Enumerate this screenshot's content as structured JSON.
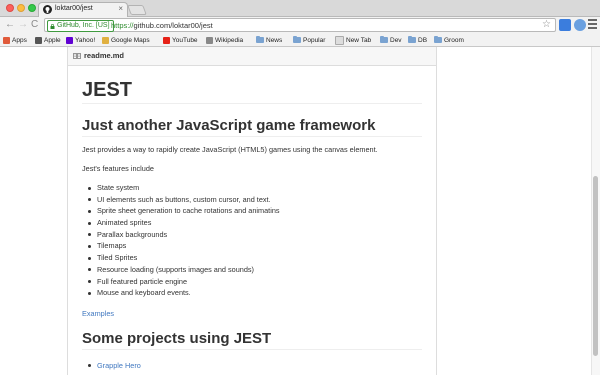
{
  "browser": {
    "tab_title": "loktar00/jest",
    "tab_close": "×",
    "ev_badge": "GitHub, Inc. [US]",
    "url_scheme": "https://",
    "url_rest": "github.com/loktar00/jest",
    "star": "☆",
    "nav": {
      "back": "←",
      "forward": "→",
      "reload": "C"
    }
  },
  "bookmarks": [
    {
      "label": "Apps",
      "icon": "apps-grid-icon",
      "color": "#e05a3a"
    },
    {
      "label": "Apple",
      "icon": "apple-icon",
      "color": "#555555"
    },
    {
      "label": "Yahoo!",
      "icon": "yahoo-icon",
      "color": "#6001d2"
    },
    {
      "label": "Google Maps",
      "icon": "google-maps-icon",
      "color": "#e0b040"
    },
    {
      "label": "YouTube",
      "icon": "youtube-icon",
      "color": "#e62117"
    },
    {
      "label": "Wikipedia",
      "icon": "wikipedia-icon",
      "color": "#888888"
    },
    {
      "label": "News",
      "icon": "folder-icon",
      "color": "#7aa3d1"
    },
    {
      "label": "Popular",
      "icon": "folder-icon",
      "color": "#7aa3d1"
    },
    {
      "label": "New Tab",
      "icon": "page-icon",
      "color": "#dddddd"
    },
    {
      "label": "Dev",
      "icon": "folder-icon",
      "color": "#7aa3d1"
    },
    {
      "label": "DB",
      "icon": "folder-icon",
      "color": "#7aa3d1"
    },
    {
      "label": "Groom",
      "icon": "folder-icon",
      "color": "#7aa3d1"
    }
  ],
  "readme": {
    "filename": "readme.md",
    "h1": "JEST",
    "subtitle": "Just another JavaScript game framework",
    "intro": "Jest provides a way to rapidly create JavaScript (HTML5) games using the canvas element.",
    "features_intro": "Jest's features include",
    "features": [
      "State system",
      "UI elements such as buttons, custom cursor, and text.",
      "Sprite sheet generation to cache rotations and animatins",
      "Animated sprites",
      "Parallax backgrounds",
      "Tilemaps",
      "Tiled Sprites",
      "Resource loading (supports images and sounds)",
      "Full featured particle engine",
      "Mouse and keyboard events."
    ],
    "examples_link": "Examples",
    "projects_heading": "Some projects using JEST",
    "projects": [
      "Grapple Hero"
    ]
  },
  "colors": {
    "link": "#4078c0",
    "ev_green": "#2e8b2e"
  }
}
